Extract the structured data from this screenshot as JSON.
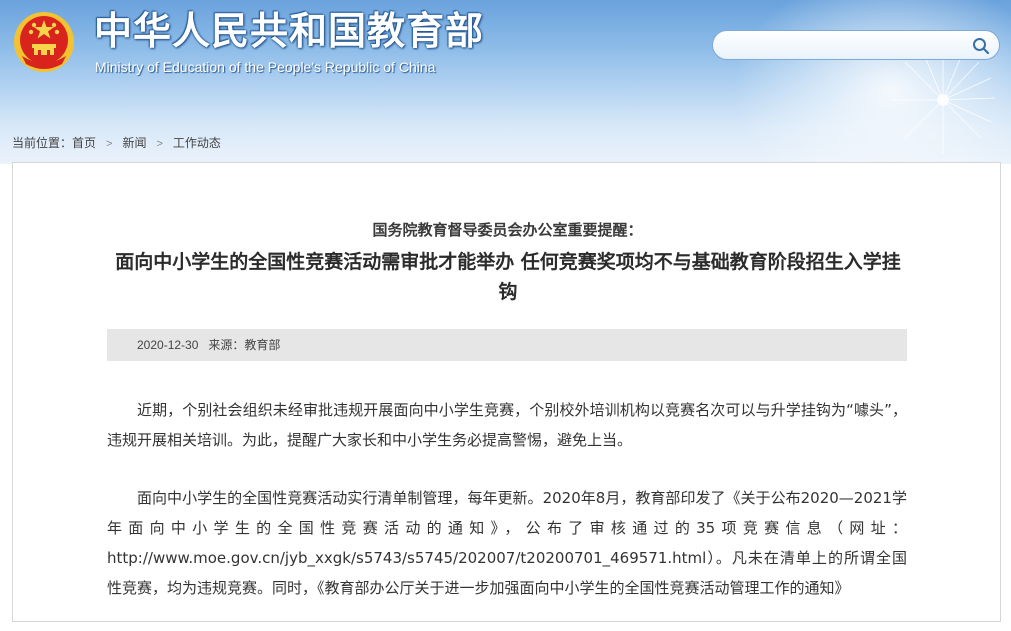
{
  "header": {
    "title": "中华人民共和国教育部",
    "subtitle": "Ministry of Education of the People's Republic of China",
    "search_placeholder": "",
    "colors": {
      "title_text": "#ffffff",
      "sky_top": "#6aa2dc",
      "emblem_red": "#d8241c",
      "emblem_gold": "#f2c232"
    }
  },
  "breadcrumb": {
    "prefix": "当前位置：",
    "items": [
      "首页",
      "新闻",
      "工作动态"
    ]
  },
  "article": {
    "kicker": "国务院教育督导委员会办公室重要提醒：",
    "headline": "面向中小学生的全国性竞赛活动需审批才能举办 任何竞赛奖项均不与基础教育阶段招生入学挂钩",
    "date": "2020-12-30",
    "source": "来源：教育部",
    "paragraphs": [
      "近期，个别社会组织未经审批违规开展面向中小学生竞赛，个别校外培训机构以竞赛名次可以与升学挂钩为“噱头”，违规开展相关培训。为此，提醒广大家长和中小学生务必提高警惕，避免上当。",
      "面向中小学生的全国性竞赛活动实行清单制管理，每年更新。2020年8月，教育部印发了《关于公布2020—2021学年面向中小学生的全国性竞赛活动的通知》，公布了审核通过的35项竞赛信息（网址：http://www.moe.gov.cn/jyb_xxgk/s5743/s5745/202007/t20200701_469571.html）。凡未在清单上的所谓全国性竞赛，均为违规竞赛。同时，《教育部办公厅关于进一步加强面向中小学生的全国性竞赛活动管理工作的通知》"
    ]
  }
}
